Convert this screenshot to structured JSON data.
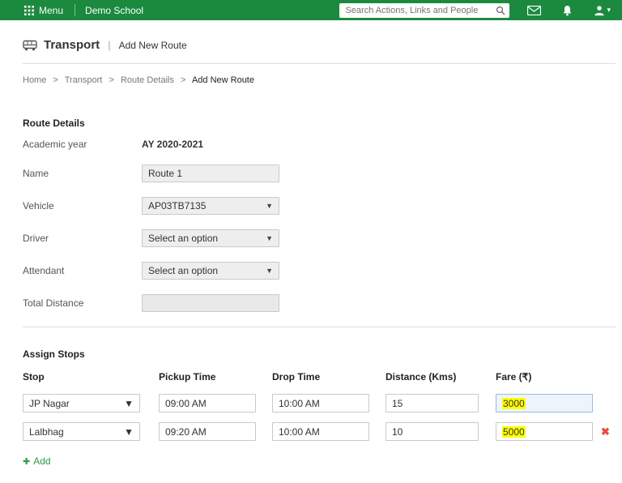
{
  "topbar": {
    "menu_label": "Menu",
    "school_name": "Demo School",
    "search_placeholder": "Search Actions, Links and People"
  },
  "header": {
    "title": "Transport",
    "subtitle": "Add New Route"
  },
  "breadcrumb": {
    "items": [
      "Home",
      "Transport",
      "Route Details",
      "Add New Route"
    ],
    "separator": ">"
  },
  "route_details": {
    "heading": "Route Details",
    "academic_year_label": "Academic year",
    "academic_year_value": "AY 2020-2021",
    "name_label": "Name",
    "name_value": "Route 1",
    "vehicle_label": "Vehicle",
    "vehicle_value": "AP03TB7135",
    "driver_label": "Driver",
    "driver_value": "Select an option",
    "attendant_label": "Attendant",
    "attendant_value": "Select an option",
    "total_distance_label": "Total Distance",
    "total_distance_value": ""
  },
  "assign_stops": {
    "heading": "Assign Stops",
    "columns": [
      "Stop",
      "Pickup Time",
      "Drop Time",
      "Distance (Kms)",
      "Fare (₹)"
    ],
    "rows": [
      {
        "stop": "JP Nagar",
        "pickup": "09:00 AM",
        "drop": "10:00 AM",
        "distance": "15",
        "fare": "3000"
      },
      {
        "stop": "Lalbhag",
        "pickup": "09:20 AM",
        "drop": "10:00 AM",
        "distance": "10",
        "fare": "5000"
      }
    ],
    "add_label": "Add",
    "delete_symbol": "✖"
  },
  "colors": {
    "topbar_green": "#1b8a3e",
    "highlight_yellow": "#ffff00",
    "delete_red": "#e84c3d",
    "link_green": "#2e9a44"
  }
}
